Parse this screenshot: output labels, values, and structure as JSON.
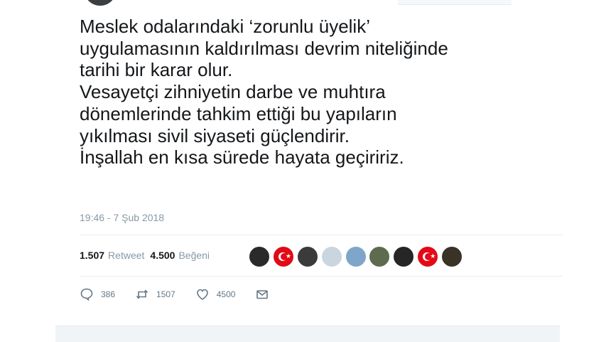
{
  "tweet": {
    "lines": [
      "Meslek odalarındaki ‘zorunlu üyelik’",
      "uygulamasının kaldırılması devrim niteliğinde",
      "tarihi bir karar olur.",
      "Vesayetçi zihniyetin darbe ve muhtıra",
      "dönemlerinde tahkim ettiği bu yapıların",
      "yıkılması sivil siyaseti güçlendirir.",
      "İnşallah en kısa sürede hayata geçiririz."
    ],
    "timestamp": "19:46 - 7 Şub 2018"
  },
  "stats": {
    "retweets": "1.507",
    "retweets_label": "Retweet",
    "likes": "4.500",
    "likes_label": "Beğeni"
  },
  "likers": [
    {
      "kind": "photo",
      "color": "#2a2a2a"
    },
    {
      "kind": "flag",
      "color": "#e30a17"
    },
    {
      "kind": "photo",
      "color": "#3b3b3b"
    },
    {
      "kind": "photo",
      "color": "#c9d6e0"
    },
    {
      "kind": "photo",
      "color": "#7fa6c9"
    },
    {
      "kind": "photo",
      "color": "#5e6b4f"
    },
    {
      "kind": "photo",
      "color": "#262626"
    },
    {
      "kind": "flag",
      "color": "#e30a17"
    },
    {
      "kind": "photo",
      "color": "#3a3226"
    }
  ],
  "actions": {
    "reply_count": "386",
    "retweet_count": "1507",
    "like_count": "4500"
  },
  "colors": {
    "text": "#14171a",
    "muted": "#8899a6",
    "icon": "#657786",
    "divider": "#e6ecf0"
  }
}
